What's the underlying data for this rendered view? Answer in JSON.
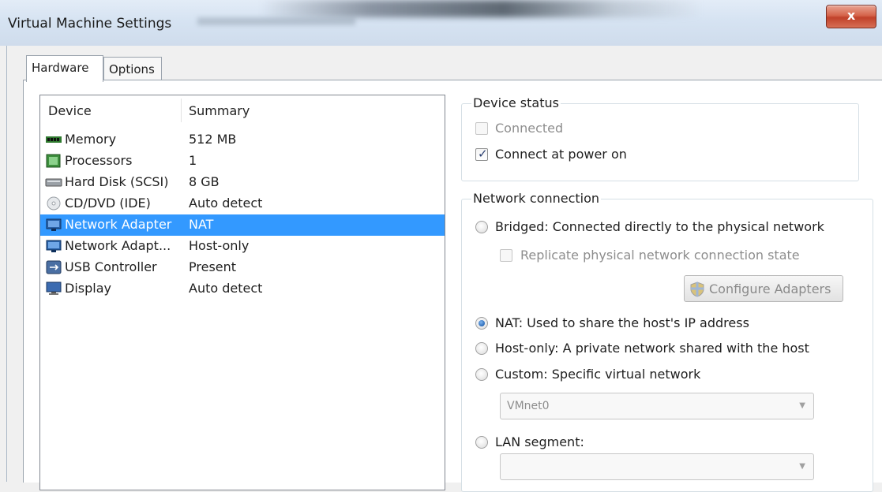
{
  "window": {
    "title": "Virtual Machine Settings",
    "close_glyph": "x"
  },
  "tabs": [
    {
      "label": "Hardware",
      "active": true
    },
    {
      "label": "Options",
      "active": false
    }
  ],
  "device_list": {
    "columns": [
      "Device",
      "Summary"
    ],
    "rows": [
      {
        "icon": "memory-icon",
        "name": "Memory",
        "summary": "512 MB",
        "selected": false
      },
      {
        "icon": "processor-icon",
        "name": "Processors",
        "summary": "1",
        "selected": false
      },
      {
        "icon": "hard-disk-icon",
        "name": "Hard Disk (SCSI)",
        "summary": "8 GB",
        "selected": false
      },
      {
        "icon": "cd-dvd-icon",
        "name": "CD/DVD (IDE)",
        "summary": "Auto detect",
        "selected": false
      },
      {
        "icon": "network-adapter-icon",
        "name": "Network Adapter",
        "summary": "NAT",
        "selected": true
      },
      {
        "icon": "network-adapter-icon",
        "name": "Network Adapt...",
        "summary": "Host-only",
        "selected": false
      },
      {
        "icon": "usb-icon",
        "name": "USB Controller",
        "summary": "Present",
        "selected": false
      },
      {
        "icon": "display-icon",
        "name": "Display",
        "summary": "Auto detect",
        "selected": false
      }
    ]
  },
  "device_status": {
    "title": "Device status",
    "connected": {
      "label": "Connected",
      "checked": false,
      "enabled": false
    },
    "connect_at_power_on": {
      "label": "Connect at power on",
      "checked": true,
      "enabled": true
    }
  },
  "network_connection": {
    "title": "Network connection",
    "bridged": {
      "label": "Bridged: Connected directly to the physical network",
      "selected": false
    },
    "replicate": {
      "label": "Replicate physical network connection state",
      "checked": false,
      "enabled": false
    },
    "configure_adapters": {
      "label": "Configure Adapters",
      "icon": "shield-icon"
    },
    "nat": {
      "label": "NAT: Used to share the host's IP address",
      "selected": true
    },
    "host_only": {
      "label": "Host-only: A private network shared with the host",
      "selected": false
    },
    "custom": {
      "label": "Custom: Specific virtual network",
      "selected": false
    },
    "vmnet_select": {
      "value": "VMnet0"
    },
    "lan_segment": {
      "label": "LAN segment:",
      "selected": false
    },
    "lan_select": {
      "value": ""
    }
  },
  "colors": {
    "selection": "#3399ff",
    "close_button": "#c0412a",
    "titlebar": "#d6e3f2"
  }
}
